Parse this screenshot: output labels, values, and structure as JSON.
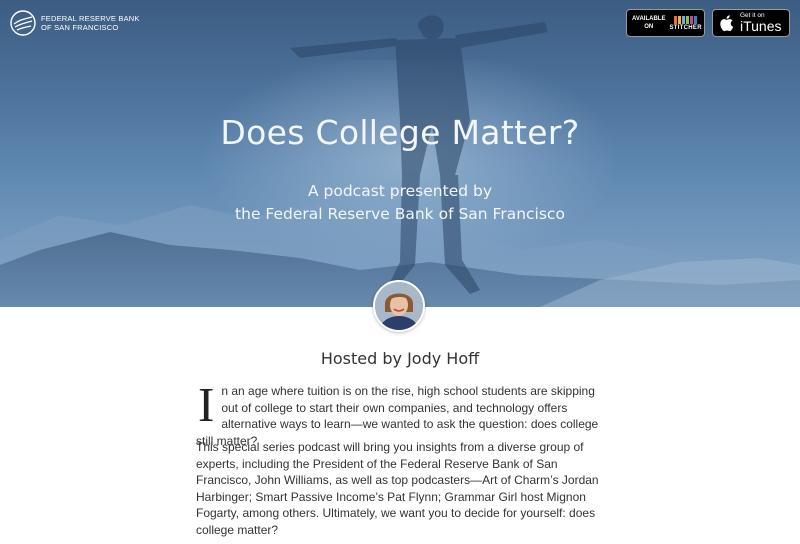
{
  "org": {
    "logo_line1": "FEDERAL RESERVE BANK",
    "logo_line2": "OF SAN FRANCISCO"
  },
  "badges": {
    "stitcher": {
      "line1": "AVAILABLE",
      "line2": "ON",
      "brand": "STITCHER"
    },
    "itunes": {
      "small": "Get it on",
      "big": "iTunes"
    }
  },
  "hero": {
    "title": "Does College Matter?",
    "subtitle_line1": "A podcast presented by",
    "subtitle_line2": "the Federal Reserve Bank of San Francisco"
  },
  "host": {
    "label": "Hosted by Jody Hoff"
  },
  "intro": {
    "dropcap": "I",
    "text": "n an age where tuition is on the rise, high school students are skipping out of college to start their own companies, and technology offers alternative ways to learn—we wanted to ask the question: does college still matter?"
  },
  "body": {
    "paragraph": "This special series podcast will bring you insights from a diverse group of experts, including the President of the Federal Reserve Bank of San Francisco, John Williams, as well as top podcasters—Art of Charm’s Jordan Harbinger; Smart Passive Income’s Pat Flynn; Grammar Girl host Mignon Fogarty, among others. Ultimately, we want you to decide for yourself: does college matter?"
  },
  "icons": {
    "logo": "eagle-logo-icon",
    "apple": "apple-icon",
    "stitcher": "stitcher-bars-icon"
  },
  "colors": {
    "sky_top": "#3c5c82",
    "sky_bottom": "#86a6c6",
    "text_dark": "#333333",
    "badge_bg": "#000000"
  }
}
